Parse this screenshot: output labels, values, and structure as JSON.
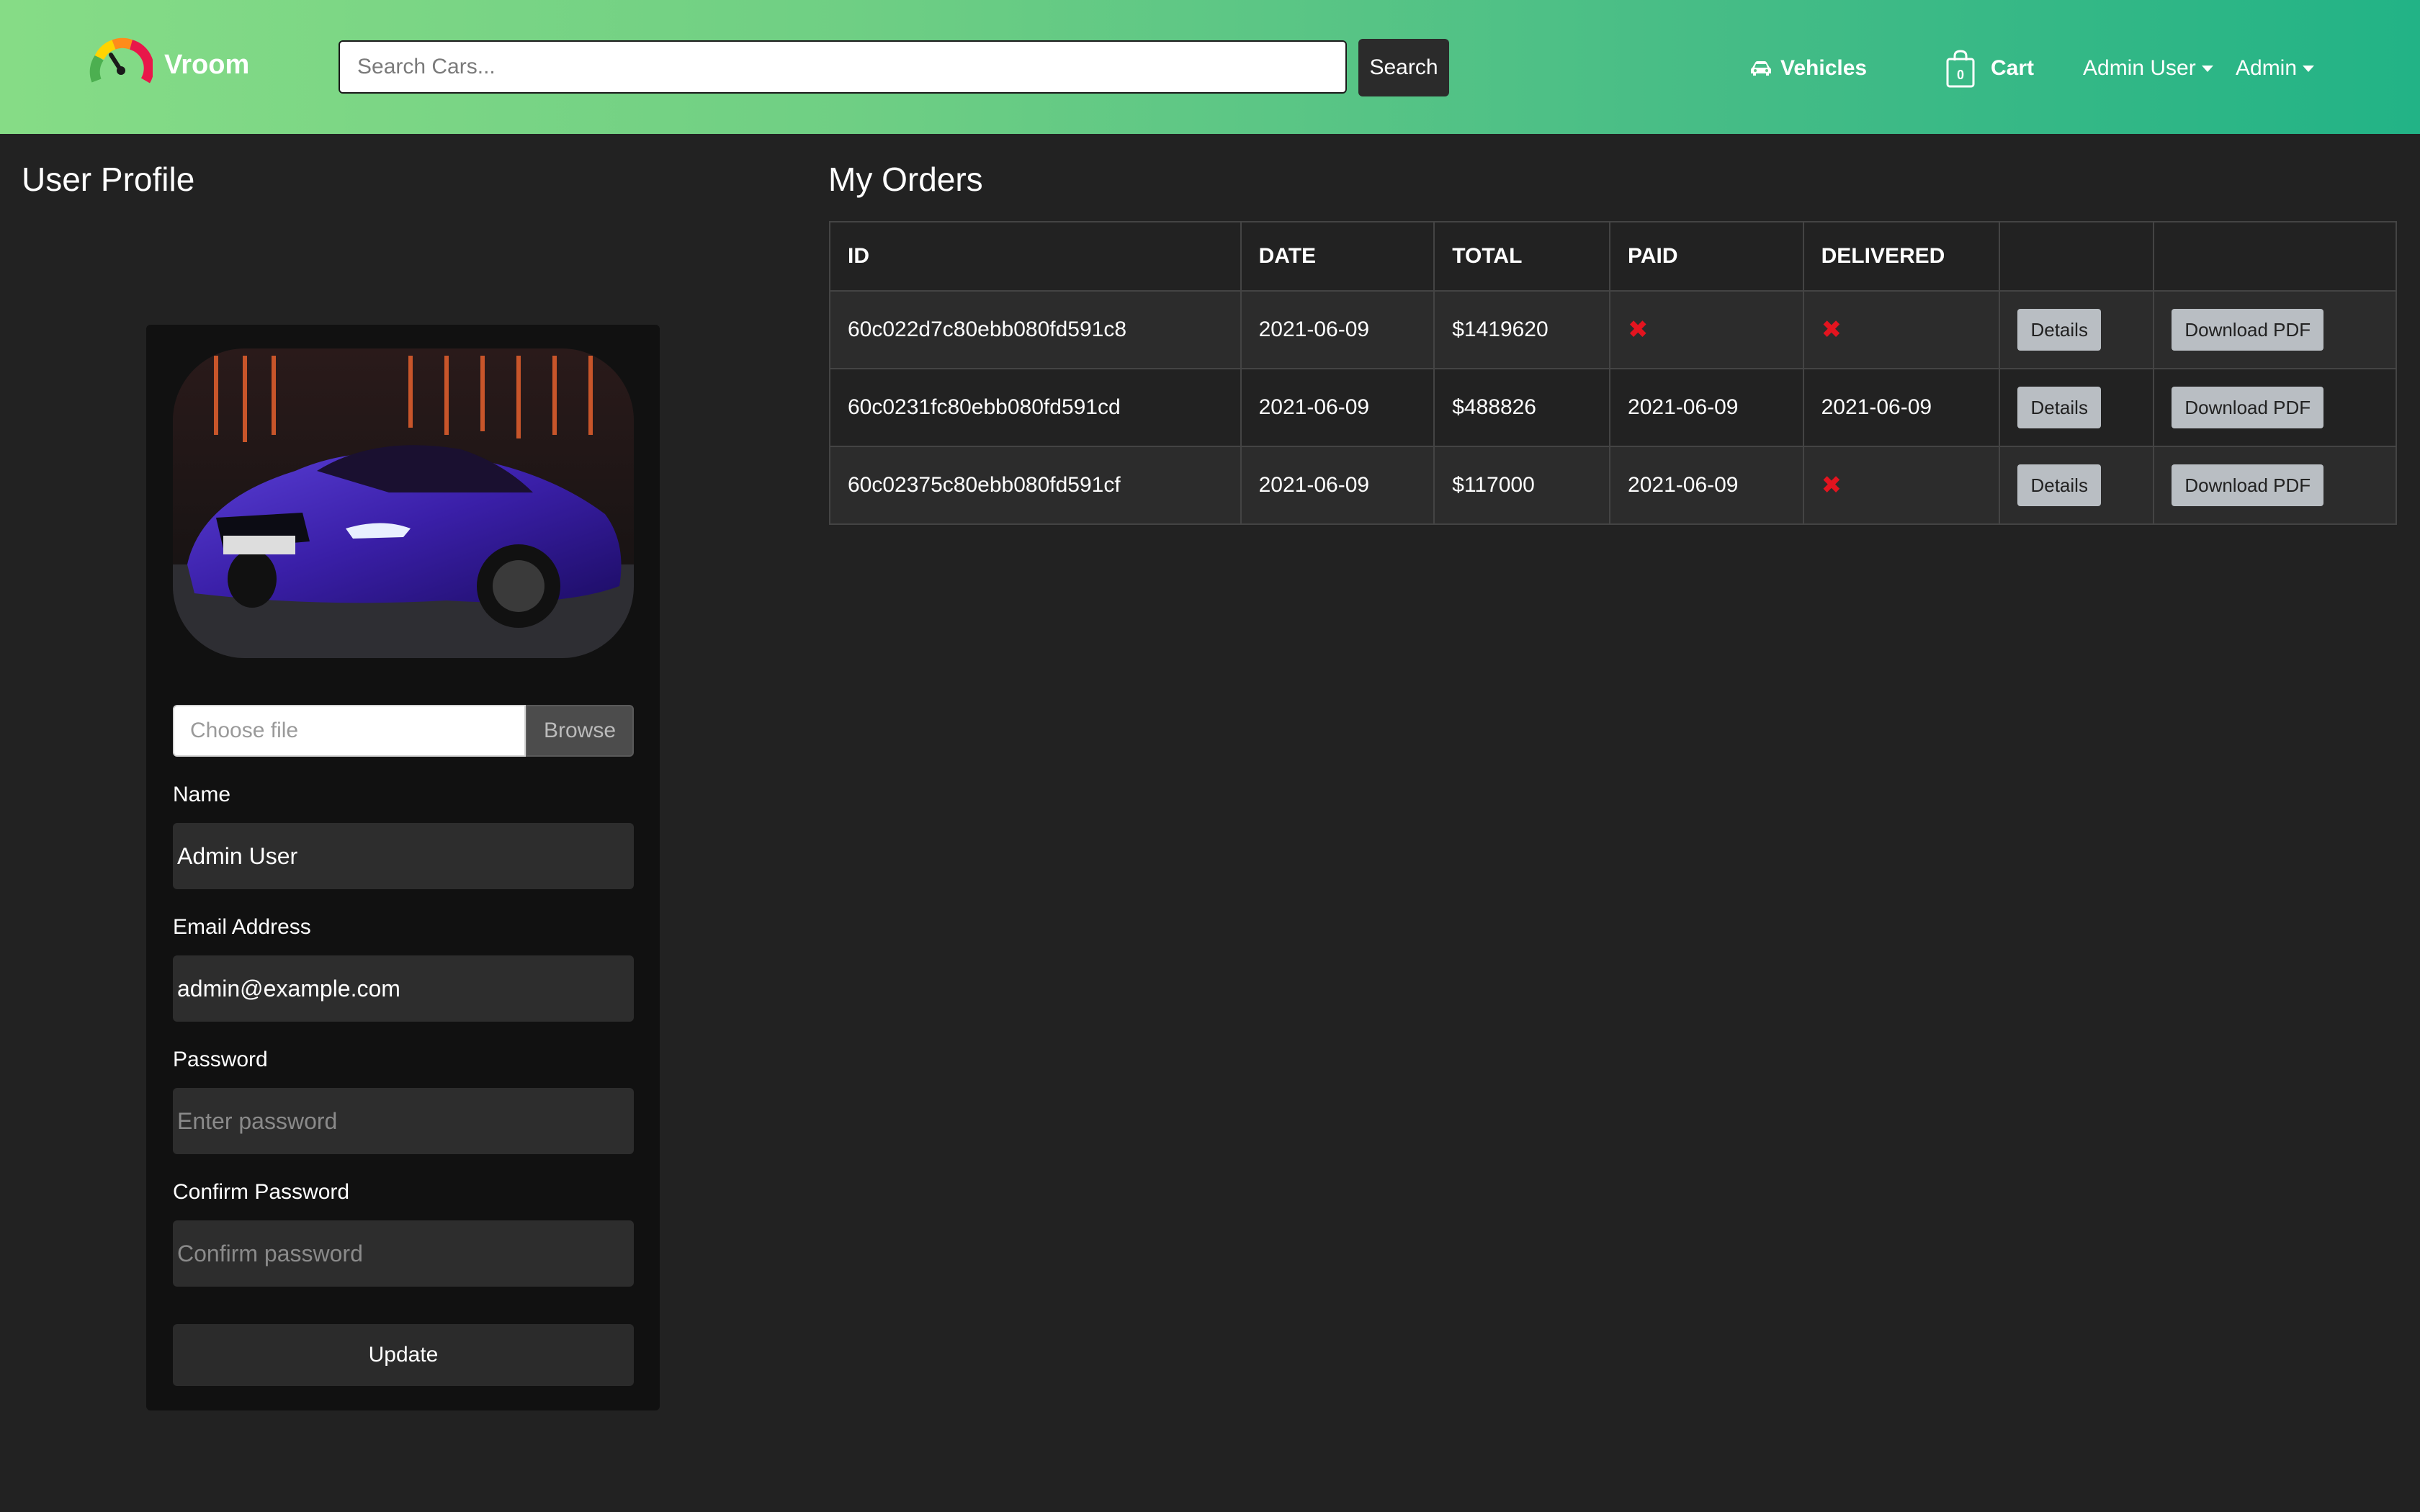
{
  "navbar": {
    "brand": "Vroom",
    "search_placeholder": "Search Cars...",
    "search_button": "Search",
    "vehicles": "Vehicles",
    "cart_count": "0",
    "cart": "Cart",
    "user_menu": "Admin User",
    "admin_menu": "Admin"
  },
  "profile": {
    "title": "User Profile",
    "file_placeholder": "Choose file",
    "browse": "Browse",
    "name_label": "Name",
    "name_value": "Admin User",
    "email_label": "Email Address",
    "email_value": "admin@example.com",
    "password_label": "Password",
    "password_placeholder": "Enter password",
    "confirm_label": "Confirm Password",
    "confirm_placeholder": "Confirm password",
    "update": "Update"
  },
  "orders": {
    "title": "My Orders",
    "headers": [
      "ID",
      "DATE",
      "TOTAL",
      "PAID",
      "DELIVERED",
      "",
      ""
    ],
    "details_label": "Details",
    "pdf_label": "Download PDF",
    "not_marker": "✖",
    "rows": [
      {
        "id": "60c022d7c80ebb080fd591c8",
        "date": "2021-06-09",
        "total": "$1419620",
        "paid": "",
        "delivered": ""
      },
      {
        "id": "60c0231fc80ebb080fd591cd",
        "date": "2021-06-09",
        "total": "$488826",
        "paid": "2021-06-09",
        "delivered": "2021-06-09"
      },
      {
        "id": "60c02375c80ebb080fd591cf",
        "date": "2021-06-09",
        "total": "$117000",
        "paid": "2021-06-09",
        "delivered": ""
      }
    ]
  },
  "colors": {
    "navbar_start": "#86dc86",
    "navbar_end": "#22b386",
    "background": "#222222",
    "card": "#111111",
    "not_marker": "#e3141f"
  }
}
